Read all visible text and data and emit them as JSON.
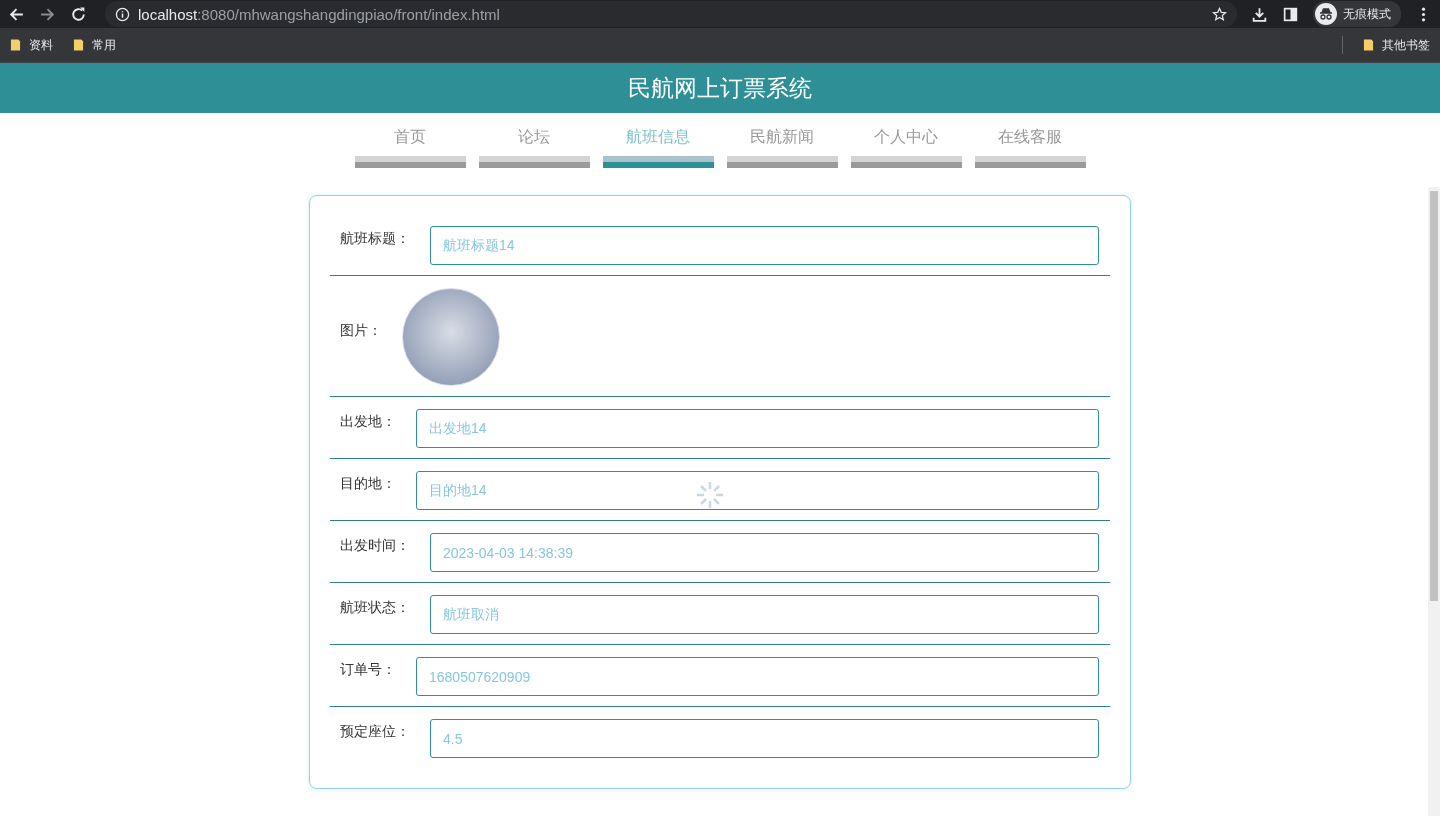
{
  "browser": {
    "url_host": "localhost",
    "url_rest": ":8080/mhwangshangdingpiao/front/index.html",
    "profile_label": "无痕模式",
    "bookmarks": [
      "资料",
      "常用"
    ],
    "other_bookmarks": "其他书签"
  },
  "header": {
    "title": "民航网上订票系统"
  },
  "nav": [
    {
      "label": "首页",
      "selected": false
    },
    {
      "label": "论坛",
      "selected": false
    },
    {
      "label": "航班信息",
      "selected": true
    },
    {
      "label": "民航新闻",
      "selected": false
    },
    {
      "label": "个人中心",
      "selected": false
    },
    {
      "label": "在线客服",
      "selected": false
    }
  ],
  "form": [
    {
      "kind": "text",
      "label": "航班标题：",
      "value": "航班标题14"
    },
    {
      "kind": "image",
      "label": "图片："
    },
    {
      "kind": "text",
      "label": "出发地：",
      "value": "出发地14"
    },
    {
      "kind": "text",
      "label": "目的地：",
      "value": "目的地14"
    },
    {
      "kind": "text",
      "label": "出发时间：",
      "value": "2023-04-03 14:38:39"
    },
    {
      "kind": "text",
      "label": "航班状态：",
      "value": "航班取消"
    },
    {
      "kind": "text",
      "label": "订单号：",
      "value": "1680507620909"
    },
    {
      "kind": "text",
      "label": "预定座位：",
      "value": "4.5"
    }
  ]
}
